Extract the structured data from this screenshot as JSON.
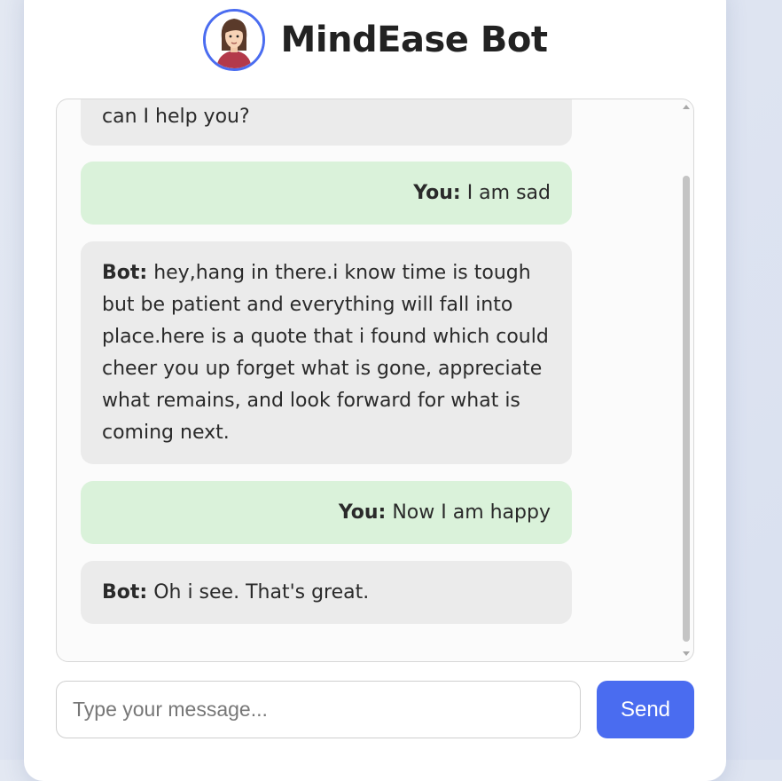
{
  "header": {
    "title": "MindEase Bot"
  },
  "chat": {
    "messages": [
      {
        "sender": "bot",
        "label": "",
        "text": "can I help you?"
      },
      {
        "sender": "user",
        "label": "You:",
        "text": "I am sad"
      },
      {
        "sender": "bot",
        "label": "Bot:",
        "text": "hey,hang in there.i know time is tough but be patient and everything will fall into place.here is a quote that i found which could cheer you up forget what is gone, appreciate what remains, and look forward for what is coming next."
      },
      {
        "sender": "user",
        "label": "You:",
        "text": "Now I am happy"
      },
      {
        "sender": "bot",
        "label": "Bot:",
        "text": "Oh i see. That's great."
      }
    ]
  },
  "composer": {
    "placeholder": "Type your message...",
    "value": "",
    "send_label": "Send"
  },
  "colors": {
    "accent": "#4a6cf0",
    "bot_bubble": "#ebebeb",
    "user_bubble": "#daf2da"
  },
  "icons": {
    "avatar": "woman-avatar-icon"
  }
}
